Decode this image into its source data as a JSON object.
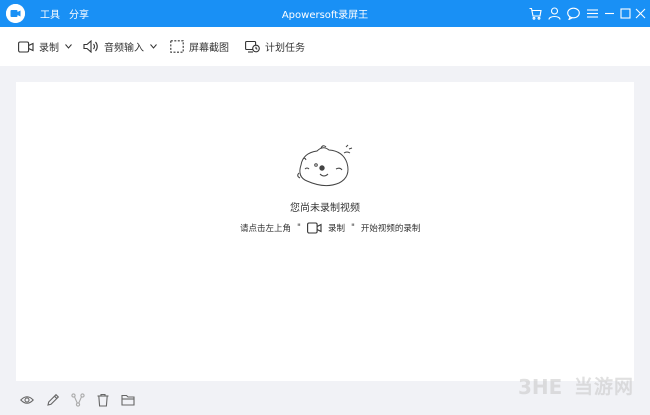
{
  "titlebar": {
    "title": "Apowersoft录屏王",
    "menu": {
      "tools": "工具",
      "share": "分享"
    }
  },
  "toolbar": {
    "record_label": "录制",
    "audio_label": "音频输入",
    "screenshot_label": "屏幕截图",
    "schedule_label": "计划任务"
  },
  "empty_state": {
    "title": "您尚未录制视频",
    "hint_prefix": "请点击左上角",
    "hint_quote_open": "\"",
    "hint_record": "录制",
    "hint_quote_close": "\"",
    "hint_suffix": "开始视频的录制"
  },
  "watermark": {
    "text": "当游网",
    "logo_text": "3HE"
  },
  "colors": {
    "titlebar": "#1990f5",
    "background": "#f1f2f6",
    "panel": "#ffffff"
  },
  "icons": {
    "titlebar": [
      "cart-icon",
      "user-icon",
      "chat-icon",
      "menu-icon",
      "minimize-icon",
      "maximize-icon",
      "close-icon"
    ],
    "bottom": [
      "eye-icon",
      "edit-icon",
      "share-icon",
      "trash-icon",
      "folder-icon"
    ]
  }
}
